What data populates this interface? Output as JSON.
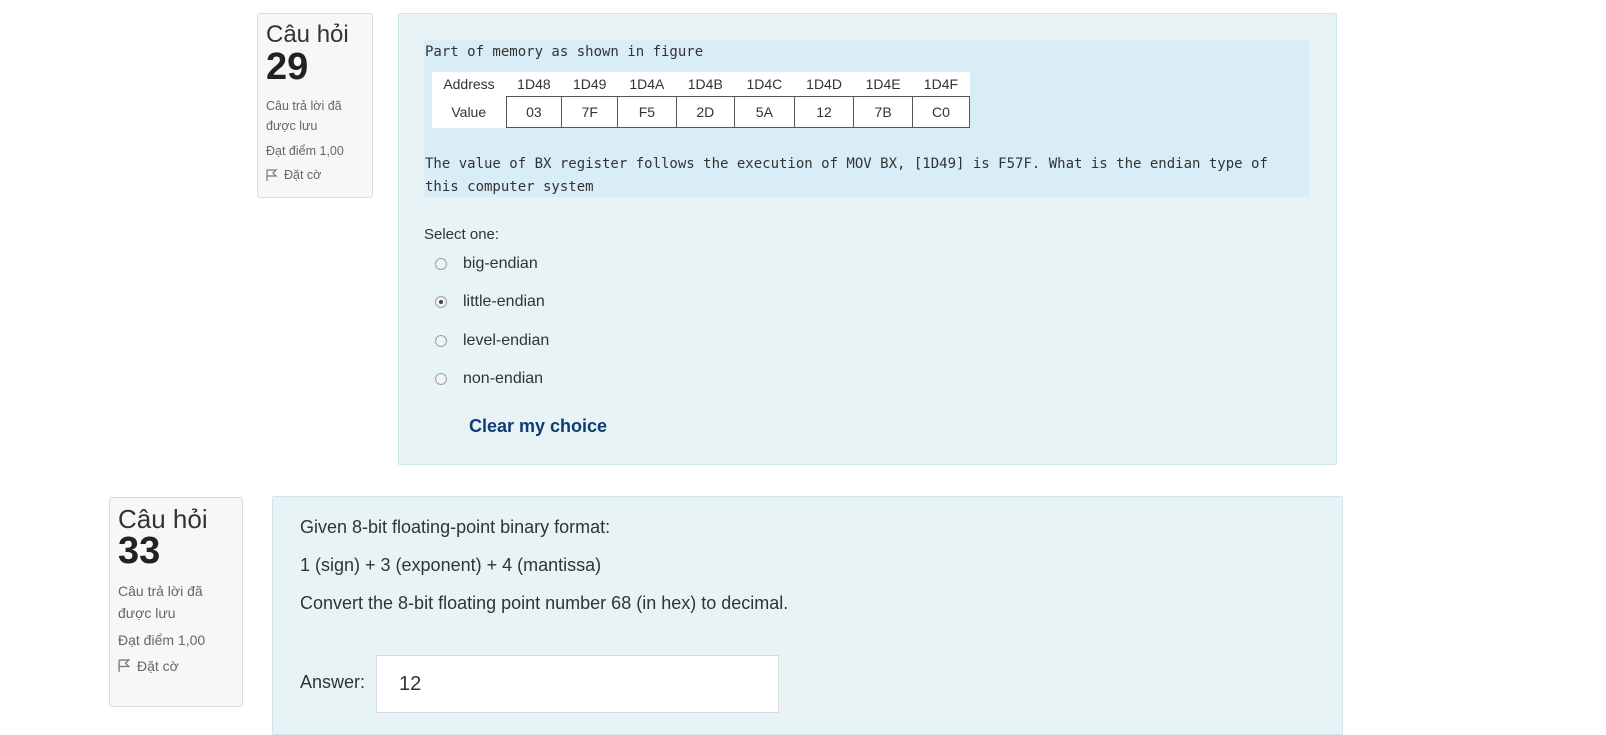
{
  "q29": {
    "info": {
      "label": "Câu hỏi",
      "number": "29",
      "state": "Câu trả lời đã được lưu",
      "grade": "Đạt điểm 1,00",
      "flag": "Đặt cờ",
      "flag_icon": "flag-icon"
    },
    "intro": "Part of memory as shown in figure",
    "table": {
      "address_header": "Address",
      "value_header": "Value",
      "addresses": [
        "1D48",
        "1D49",
        "1D4A",
        "1D4B",
        "1D4C",
        "1D4D",
        "1D4E",
        "1D4F"
      ],
      "values": [
        "03",
        "7F",
        "F5",
        "2D",
        "5A",
        "12",
        "7B",
        "C0"
      ]
    },
    "question": "The value of BX register follows the execution of MOV BX, [1D49] is F57F. What is the endian type of this computer system",
    "select_label": "Select one:",
    "options": [
      {
        "label": "big-endian",
        "checked": false
      },
      {
        "label": "little-endian",
        "checked": true
      },
      {
        "label": "level-endian",
        "checked": false
      },
      {
        "label": "non-endian",
        "checked": false
      }
    ],
    "clear_label": "Clear my choice"
  },
  "q33": {
    "info": {
      "label": "Câu hỏi",
      "number": "33",
      "state": "Câu trả lời đã được lưu",
      "grade": "Đạt điểm 1,00",
      "flag": "Đặt cờ",
      "flag_icon": "flag-icon"
    },
    "line1": "Given 8-bit floating-point binary format:",
    "line2": "1 (sign) + 3 (exponent) + 4 (mantissa)",
    "line3": "Convert the 8-bit floating point number 68 (in hex) to decimal.",
    "answer_label": "Answer:",
    "answer_value": "12"
  }
}
